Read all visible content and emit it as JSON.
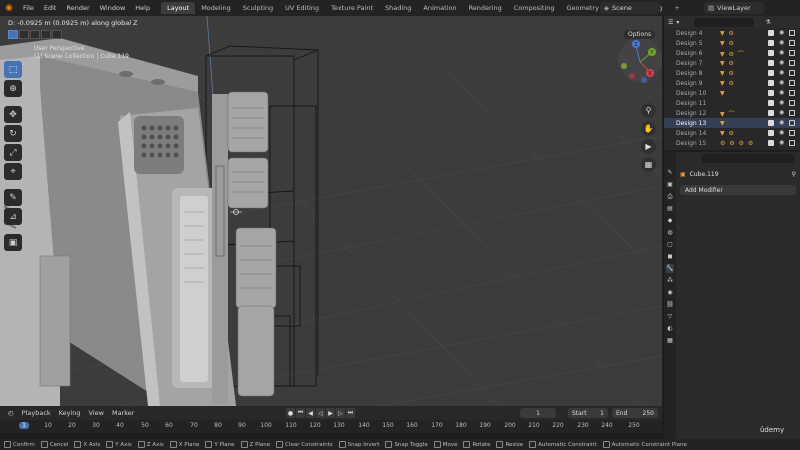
{
  "menu": [
    "File",
    "Edit",
    "Render",
    "Window",
    "Help"
  ],
  "workspaces": [
    "Layout",
    "Modeling",
    "Sculpting",
    "UV Editing",
    "Texture Paint",
    "Shading",
    "Animation",
    "Rendering",
    "Compositing",
    "Geometry Nodes",
    "Scripting"
  ],
  "workspace_add": "+",
  "scene": "Scene",
  "view_layer": "ViewLayer",
  "viewport": {
    "hint": "D: -0.0925 m (0.0925 m) along global Z",
    "perspective": "User Perspective",
    "collection": "(1) Scene Collection | Cube.119",
    "options": "Options",
    "gizmo_y": "Y",
    "gizmo_z": "Z",
    "gizmo_x": "X"
  },
  "outliner": {
    "rows": [
      {
        "name": "Design 4",
        "icons": "▼ ⚙"
      },
      {
        "name": "Design 5",
        "icons": "▼ ⚙"
      },
      {
        "name": "Design 6",
        "icons": "▼ ⚙ ⌒"
      },
      {
        "name": "Design 7",
        "icons": "▼ ⚙"
      },
      {
        "name": "Design 8",
        "icons": "▼ ⚙"
      },
      {
        "name": "Design 9",
        "icons": "▼ ⚙"
      },
      {
        "name": "Design 10",
        "icons": "▼"
      },
      {
        "name": "Design 11",
        "icons": ""
      },
      {
        "name": "Design 12",
        "icons": "▼ ⌒"
      },
      {
        "name": "Design 13",
        "icons": "▼"
      },
      {
        "name": "Design 14",
        "icons": "▼ ⚙"
      },
      {
        "name": "Design 15",
        "icons": "⚙ ⚙ ⚙ ⚙"
      }
    ],
    "highlight_index": 9
  },
  "properties": {
    "object_name": "Cube.119",
    "add_modifier": "Add Modifier"
  },
  "timeline": {
    "menus": [
      "Playback",
      "Keying",
      "View",
      "Marker"
    ],
    "current_frame": "1",
    "start_label": "Start",
    "start": "1",
    "end_label": "End",
    "end": "250",
    "ruler": [
      "1",
      "10",
      "20",
      "30",
      "40",
      "50",
      "60",
      "70",
      "80",
      "90",
      "100",
      "110",
      "120",
      "130",
      "140",
      "150",
      "160",
      "170",
      "180",
      "190",
      "200",
      "210",
      "220",
      "230",
      "240",
      "250"
    ]
  },
  "status": [
    "Confirm",
    "Cancel",
    "X Axis",
    "Y Axis",
    "Z Axis",
    "X Plane",
    "Y Plane",
    "Z Plane",
    "Clear Constraints",
    "Snap Invert",
    "Snap Toggle",
    "Move",
    "Rotate",
    "Resize",
    "Automatic Constraint",
    "Automatic Constraint Plane"
  ],
  "watermark": "ûdemy",
  "colors": {
    "accent": "#4772b3",
    "orange": "#e87d0d",
    "viewport_bg": "#3c3c3c"
  }
}
